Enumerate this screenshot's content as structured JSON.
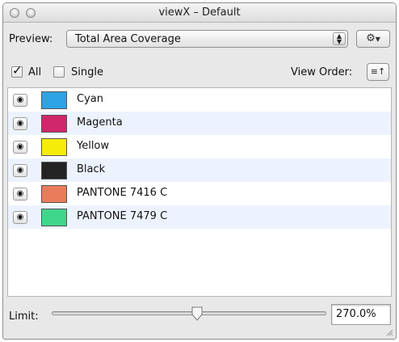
{
  "window": {
    "title": "viewX – Default"
  },
  "preview": {
    "label": "Preview:",
    "selected": "Total Area Coverage",
    "gear_icon": "gear-icon",
    "arrows_glyph": "▴▾"
  },
  "options": {
    "all_label": "All",
    "all_checked": true,
    "single_label": "Single",
    "single_checked": false,
    "view_order_label": "View Order:",
    "view_order_glyph": "≡↑"
  },
  "separations": [
    {
      "name": "Cyan",
      "color": "#2ea3e4"
    },
    {
      "name": "Magenta",
      "color": "#d0266c"
    },
    {
      "name": "Yellow",
      "color": "#f6ec0a"
    },
    {
      "name": "Black",
      "color": "#232323"
    },
    {
      "name": "PANTONE 7416 C",
      "color": "#ea7c5c"
    },
    {
      "name": "PANTONE 7479 C",
      "color": "#3fd68c"
    }
  ],
  "limit": {
    "label": "Limit:",
    "value": "270.0%",
    "slider_fraction": 0.53
  }
}
